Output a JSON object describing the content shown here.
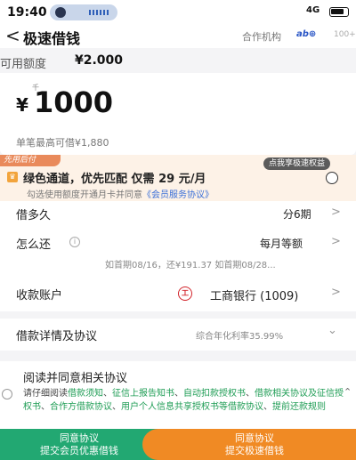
{
  "status": {
    "time": "19:40",
    "network": "4G"
  },
  "nav": {
    "back_glyph": "<",
    "title": "极速借钱",
    "partner_label": "合作机构",
    "partner_logo": "ab⊕",
    "partner_count": "100+"
  },
  "available": {
    "label": "可用额度",
    "value": "¥2.000"
  },
  "amount": {
    "unit": "千",
    "currency": "¥",
    "value": "1000",
    "max_note": "单笔最高可借¥1,880"
  },
  "promo": {
    "tag": "先用后付",
    "bubble": "点我享极速权益",
    "crown_glyph": "♛",
    "main_text": "绿色通道，优先匹配  仅需",
    "price": "29",
    "price_unit": "元/月",
    "sub_text": "勾选使用额度开通月卡并同意",
    "sub_link": "《会员服务协议》"
  },
  "rows": {
    "term": {
      "label": "借多久",
      "value": "分6期"
    },
    "repay": {
      "label": "怎么还",
      "info_glyph": "i",
      "value": "每月等额",
      "detail": "如首期08/16，还¥191.37  如首期08/28..."
    },
    "account": {
      "label": "收款账户",
      "bank_glyph": "工",
      "value": "工商银行 (1009)"
    },
    "chevron": ">"
  },
  "details": {
    "label": "借款详情及协议",
    "rate": "综合年化利率35.99%",
    "caret": "⌄"
  },
  "agreement": {
    "title": "阅读并同意相关协议",
    "prefix": "请仔细阅读",
    "links": [
      "借款须知",
      "征信上报告知书",
      "自动扣款授权书",
      "借款相关协议及征信授权书",
      "合作方借款协议",
      "用户个人信息共享授权书等借款协议",
      "提前还款规则"
    ],
    "caret": "⌃"
  },
  "buttons": {
    "left": {
      "line1": "同意协议",
      "line2": "提交会员优惠借钱"
    },
    "right": {
      "line1": "同意协议",
      "line2": "提交极速借钱"
    }
  },
  "colors": {
    "green": "#22a872",
    "orange": "#f08a24",
    "link_blue": "#3a6fd8",
    "promo_bg": "#fdf2e7"
  },
  "icons": [
    "back-icon",
    "crown-icon",
    "info-icon",
    "bank-icon",
    "chevron-right-icon",
    "chevron-down-icon",
    "chevron-up-icon",
    "radio-icon"
  ]
}
